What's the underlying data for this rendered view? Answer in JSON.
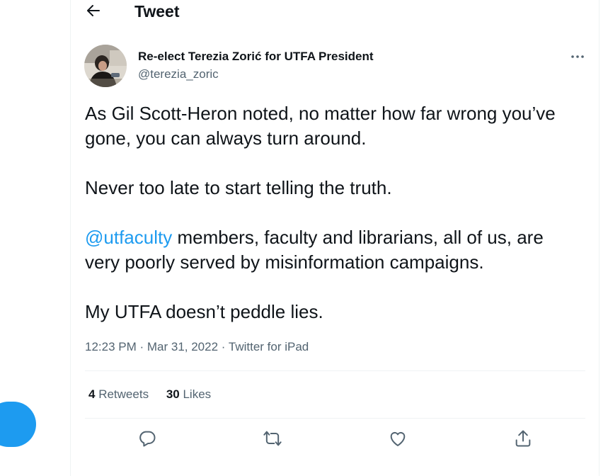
{
  "header": {
    "title": "Tweet"
  },
  "tweet": {
    "display_name": "Re-elect Terezia Zorić for UTFA President",
    "handle": "@terezia_zoric",
    "paragraphs": {
      "p1": "As Gil Scott-Heron noted, no matter how far wrong you’ve gone, you can always turn around.",
      "p2": "Never too late to start telling the truth.",
      "p3_mention": "@utfaculty",
      "p3_rest": " members, faculty and librarians, all of us, are very poorly served by misinformation campaigns.",
      "p4": "My UTFA doesn’t peddle lies."
    },
    "time": "12:23 PM",
    "date": "Mar 31, 2022",
    "source": "Twitter for iPad",
    "separator": " · "
  },
  "stats": {
    "retweets_count": "4",
    "retweets_label": "Retweets",
    "likes_count": "30",
    "likes_label": "Likes"
  },
  "colors": {
    "accent": "#1d9bf0",
    "text_primary": "#0f1419",
    "text_secondary": "#536471",
    "border": "#eff3f4"
  },
  "icons": {
    "back": "back-arrow-icon",
    "more": "more-horizontal-icon",
    "reply": "reply-icon",
    "retweet": "retweet-icon",
    "like": "like-heart-icon",
    "share": "share-icon"
  }
}
